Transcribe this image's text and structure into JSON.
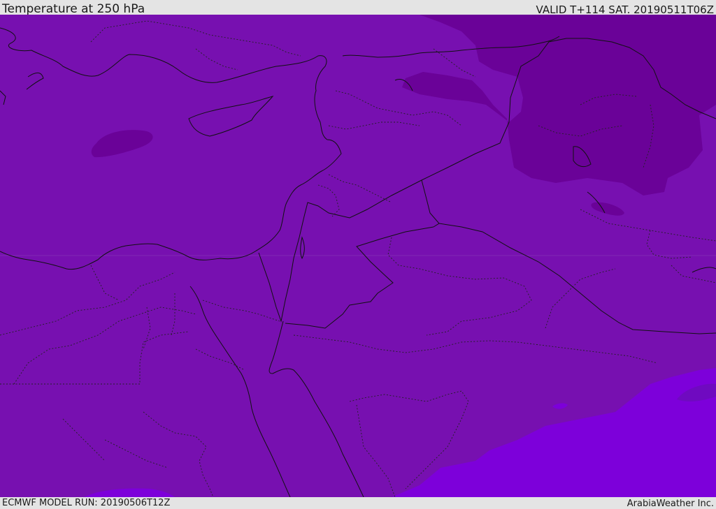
{
  "header": {
    "title": "Temperature at 250 hPa",
    "valid_time": "VALID T+114 SAT. 20190511T06Z"
  },
  "footer": {
    "model_run": "ECMWF MODEL RUN: 20190506T12Z",
    "credit": "ArabiaWeather Inc."
  },
  "map": {
    "colors": {
      "field_base": "#7710b0",
      "field_cold": "#6a0298",
      "field_warm": "#7d00da",
      "border": "#111111",
      "admin_border": "#333333"
    }
  }
}
